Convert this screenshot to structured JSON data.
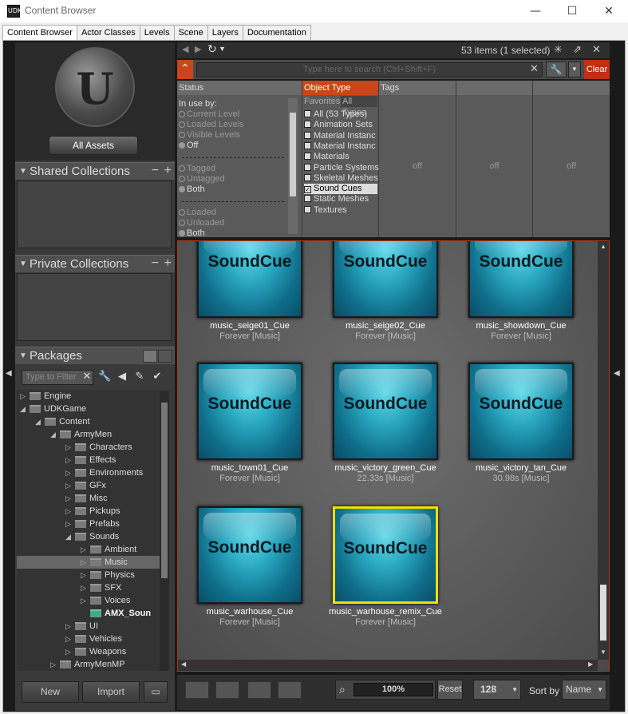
{
  "window": {
    "title": "Content Browser",
    "app_icon": "UDK",
    "minimize": "—",
    "maximize": "☐",
    "close": "✕"
  },
  "tabs": [
    {
      "label": "Content Browser",
      "active": true
    },
    {
      "label": "Actor Classes",
      "active": false
    },
    {
      "label": "Levels",
      "active": false
    },
    {
      "label": "Scene",
      "active": false
    },
    {
      "label": "Layers",
      "active": false
    },
    {
      "label": "Documentation",
      "active": false
    }
  ],
  "left": {
    "all_assets": "All Assets",
    "shared_collections": "Shared Collections",
    "private_collections": "Private Collections",
    "packages": "Packages",
    "filter_placeholder": "Type to Filter",
    "new_label": "New",
    "import_label": "Import"
  },
  "tree": [
    {
      "label": "Engine",
      "depth": 0,
      "arrow": "▷",
      "selected": false,
      "bold": false
    },
    {
      "label": "UDKGame",
      "depth": 0,
      "arrow": "◢",
      "selected": false,
      "bold": false
    },
    {
      "label": "Content",
      "depth": 1,
      "arrow": "◢",
      "selected": false,
      "bold": false
    },
    {
      "label": "ArmyMen",
      "depth": 2,
      "arrow": "◢",
      "selected": false,
      "bold": false
    },
    {
      "label": "Characters",
      "depth": 3,
      "arrow": "▷",
      "selected": false,
      "bold": false
    },
    {
      "label": "Effects",
      "depth": 3,
      "arrow": "▷",
      "selected": false,
      "bold": false
    },
    {
      "label": "Environments",
      "depth": 3,
      "arrow": "▷",
      "selected": false,
      "bold": false
    },
    {
      "label": "GFx",
      "depth": 3,
      "arrow": "▷",
      "selected": false,
      "bold": false
    },
    {
      "label": "Misc",
      "depth": 3,
      "arrow": "▷",
      "selected": false,
      "bold": false
    },
    {
      "label": "Pickups",
      "depth": 3,
      "arrow": "▷",
      "selected": false,
      "bold": false
    },
    {
      "label": "Prefabs",
      "depth": 3,
      "arrow": "▷",
      "selected": false,
      "bold": false
    },
    {
      "label": "Sounds",
      "depth": 3,
      "arrow": "◢",
      "selected": false,
      "bold": false
    },
    {
      "label": "Ambient",
      "depth": 4,
      "arrow": "▷",
      "selected": false,
      "bold": false
    },
    {
      "label": "Music",
      "depth": 4,
      "arrow": "▷",
      "selected": true,
      "bold": false
    },
    {
      "label": "Physics",
      "depth": 4,
      "arrow": "▷",
      "selected": false,
      "bold": false
    },
    {
      "label": "SFX",
      "depth": 4,
      "arrow": "▷",
      "selected": false,
      "bold": false
    },
    {
      "label": "Voices",
      "depth": 4,
      "arrow": "▷",
      "selected": false,
      "bold": false
    },
    {
      "label": "AMX_Soun",
      "depth": 4,
      "arrow": "",
      "selected": false,
      "bold": true
    },
    {
      "label": "UI",
      "depth": 3,
      "arrow": "▷",
      "selected": false,
      "bold": false
    },
    {
      "label": "Vehicles",
      "depth": 3,
      "arrow": "▷",
      "selected": false,
      "bold": false
    },
    {
      "label": "Weapons",
      "depth": 3,
      "arrow": "▷",
      "selected": false,
      "bold": false
    },
    {
      "label": "ArmyMenMP",
      "depth": 2,
      "arrow": "▷",
      "selected": false,
      "bold": false
    }
  ],
  "toolbar": {
    "items_count": "53 items (1 selected)",
    "search_placeholder": "Type here to search (Ctrl+Shift+F)",
    "clear_label": "Clear"
  },
  "filters": {
    "status_header": "Status",
    "object_type_header": "Object Type",
    "tags_header": "Tags",
    "in_use_by": "In use by:",
    "status_options": [
      {
        "label": "Current Level",
        "checked": false
      },
      {
        "label": "Loaded Levels",
        "checked": false
      },
      {
        "label": "Visible Levels",
        "checked": false
      },
      {
        "label": "Off",
        "checked": true
      }
    ],
    "tag_options": [
      {
        "label": "Tagged",
        "checked": false
      },
      {
        "label": "Untagged",
        "checked": false
      },
      {
        "label": "Both",
        "checked": true
      }
    ],
    "load_options": [
      {
        "label": "Loaded",
        "checked": false
      },
      {
        "label": "Unloaded",
        "checked": false
      },
      {
        "label": "Both",
        "checked": true
      }
    ],
    "favorites_tab": "Favorites",
    "all_types_tab": "All Types",
    "types": [
      {
        "label": "All (53 Types)",
        "checked": false
      },
      {
        "label": "Animation Sets",
        "checked": false
      },
      {
        "label": "Material Instanc",
        "checked": false
      },
      {
        "label": "Material Instanc",
        "checked": false
      },
      {
        "label": "Materials",
        "checked": false
      },
      {
        "label": "Particle Systems",
        "checked": false
      },
      {
        "label": "Skeletal Meshes",
        "checked": false
      },
      {
        "label": "Sound Cues",
        "checked": true
      },
      {
        "label": "Static Meshes",
        "checked": false
      },
      {
        "label": "Textures",
        "checked": false
      }
    ],
    "off_labels": [
      "off",
      "off",
      "off"
    ]
  },
  "assets": [
    {
      "thumb_label": "SoundCue",
      "name": "music_seige01_Cue",
      "sub": "Forever [Music]",
      "selected": false
    },
    {
      "thumb_label": "SoundCue",
      "name": "music_seige02_Cue",
      "sub": "Forever [Music]",
      "selected": false
    },
    {
      "thumb_label": "SoundCue",
      "name": "music_showdown_Cue",
      "sub": "Forever [Music]",
      "selected": false
    },
    {
      "thumb_label": "SoundCue",
      "name": "music_town01_Cue",
      "sub": "Forever [Music]",
      "selected": false
    },
    {
      "thumb_label": "SoundCue",
      "name": "music_victory_green_Cue",
      "sub": "22.33s [Music]",
      "selected": false
    },
    {
      "thumb_label": "SoundCue",
      "name": "music_victory_tan_Cue",
      "sub": "30.98s [Music]",
      "selected": false
    },
    {
      "thumb_label": "SoundCue",
      "name": "music_warhouse_Cue",
      "sub": "Forever [Music]",
      "selected": false
    },
    {
      "thumb_label": "SoundCue",
      "name": "music_warhouse_remix_Cue",
      "sub": "Forever [Music]",
      "selected": true
    }
  ],
  "statusbar": {
    "zoom": "100%",
    "reset_label": "Reset",
    "thumb_size": "128",
    "sort_by_label": "Sort by",
    "sort_value": "Name"
  },
  "colors": {
    "accent": "#c8461a",
    "selection": "#f0e000",
    "thumb": "#2aa7c0"
  }
}
